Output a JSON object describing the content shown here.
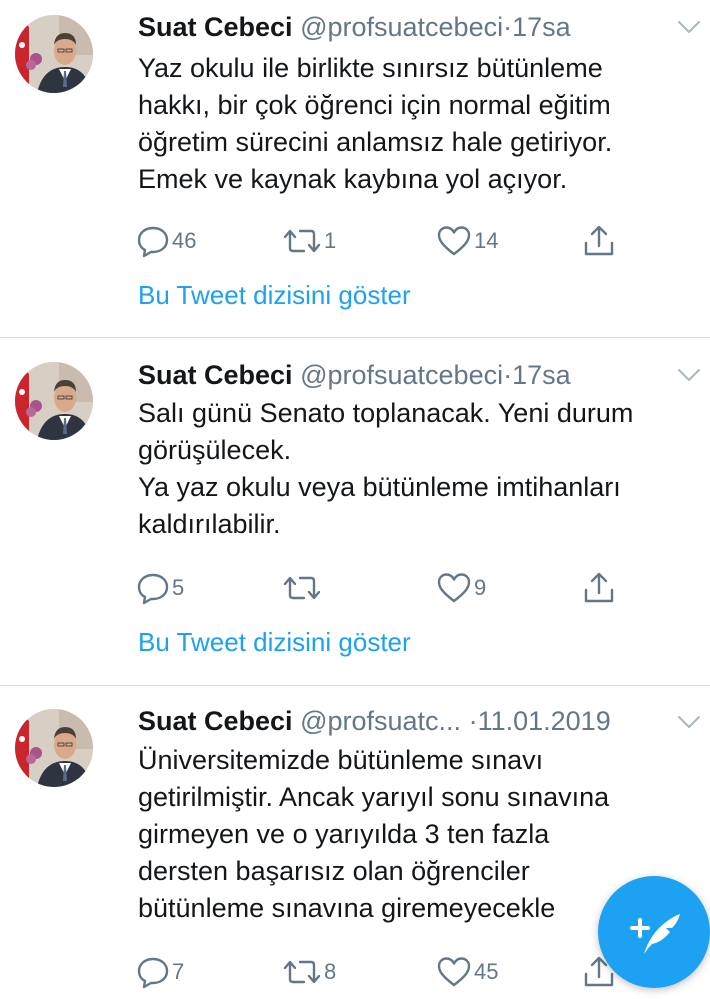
{
  "colors": {
    "accent": "#1da1f2",
    "text": "#14171a",
    "muted": "#657786",
    "divider": "#d9dee2"
  },
  "tweets": [
    {
      "name": "Suat Cebeci",
      "handle": "@profsuatcebeci",
      "separator": "·",
      "time": "17sa",
      "text": "Yaz okulu ile birlikte sınırsız bütünleme\nhakkı, bir çok öğrenci için normal eğitim\nöğretim sürecini anlamsız hale getiriyor.\nEmek ve kaynak kaybına yol açıyor.",
      "replies": "46",
      "retweets": "1",
      "likes": "14",
      "thread_link": "Bu Tweet dizisini göster"
    },
    {
      "name": "Suat Cebeci",
      "handle": "@profsuatcebeci",
      "separator": "·",
      "time": "17sa",
      "text": "Salı günü Senato toplanacak. Yeni durum\ngörüşülecek.\nYa yaz okulu veya bütünleme imtihanları\nkaldırılabilir.",
      "replies": "5",
      "retweets": "",
      "likes": "9",
      "thread_link": "Bu Tweet dizisini göster"
    },
    {
      "name": "Suat Cebeci",
      "handle": "@profsuatc...",
      "separator": "·",
      "time": "11.01.2019",
      "text": "Üniversitemizde bütünleme sınavı\ngetirilmiştir. Ancak yarıyıl sonu  sınavına\ngirmeyen ve o yarıyılda 3 ten fazla\ndersten başarısız olan öğrenciler\nbütünleme sınavına giremeyecekle",
      "replies": "7",
      "retweets": "8",
      "likes": "45"
    }
  ],
  "icons": {
    "reply": "reply-icon",
    "retweet": "retweet-icon",
    "like": "heart-icon",
    "share": "share-icon",
    "compose": "compose-tweet-icon",
    "caret": "chevron-down-icon"
  }
}
